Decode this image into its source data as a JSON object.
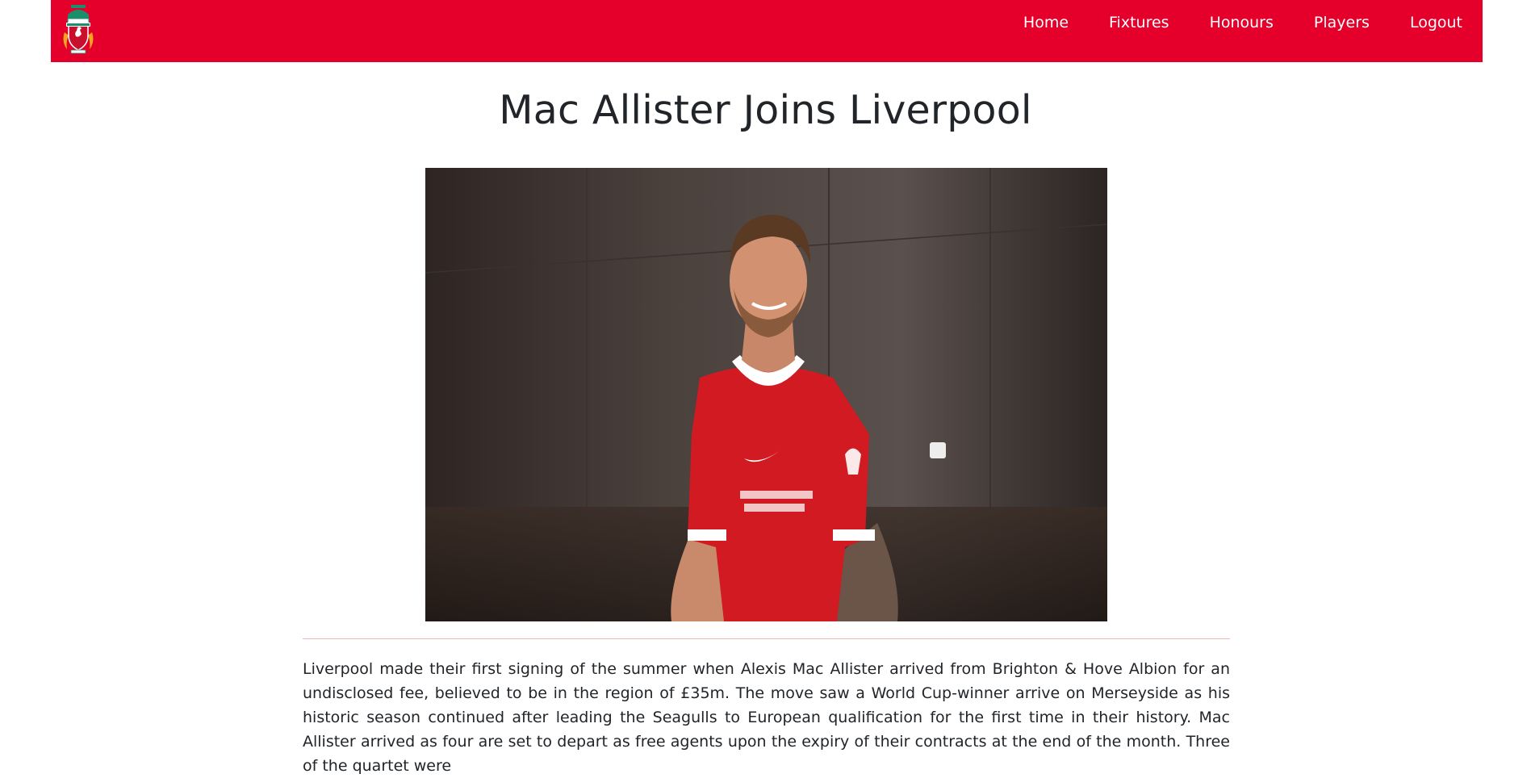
{
  "nav": {
    "items": [
      {
        "label": "Home"
      },
      {
        "label": "Fixtures"
      },
      {
        "label": "Honours"
      },
      {
        "label": "Players"
      },
      {
        "label": "Logout"
      }
    ],
    "logo_icon": "liverpool-crest-icon"
  },
  "article": {
    "title": "Mac Allister Joins Liverpool",
    "photo_icon": "player-photo",
    "body": "Liverpool made their first signing of the summer when Alexis Mac Allister arrived from Brighton & Hove Albion for an undisclosed fee, believed to be in the region of £35m. The move saw a World Cup-winner arrive on Merseyside as his historic season continued after leading the Seagulls to European qualification for the first time in their history. Mac Allister arrived as four are set to depart as free agents upon the expiry of their contracts at the end of the month. Three of the quartet were"
  },
  "colors": {
    "brand": "#e4002b",
    "nav_text": "#ffffff",
    "text": "#212529",
    "divider": "#f2b8b8"
  }
}
